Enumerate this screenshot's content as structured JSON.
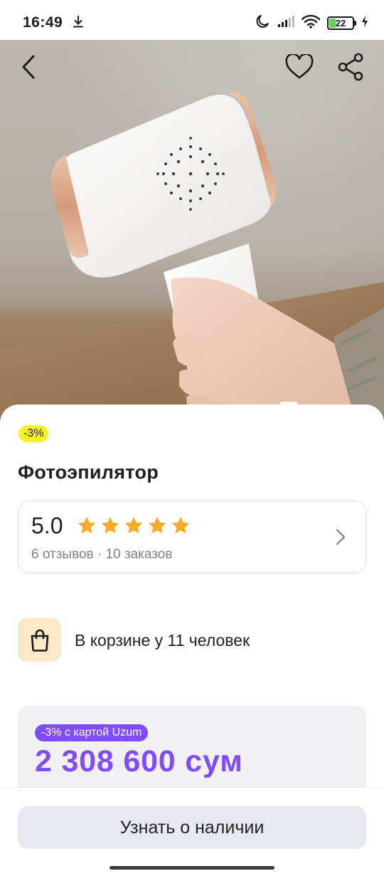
{
  "status_bar": {
    "time": "16:49",
    "battery_percent": "22",
    "icons": [
      "download-icon",
      "moon-icon",
      "signal-icon",
      "wifi-icon",
      "battery-icon",
      "charging-icon"
    ]
  },
  "header": {
    "icons": [
      "back-arrow-icon",
      "heart-icon",
      "share-icon"
    ]
  },
  "gallery": {
    "indicator_active_index": 0
  },
  "product": {
    "discount_badge": "-3%",
    "title": "Фотоэпилятор",
    "rating": {
      "value": "5.0",
      "stars": 5,
      "meta": "6 отзывов · 10 заказов"
    },
    "cart_info": "В корзине у 11 человек",
    "price_block": {
      "card_badge": "-3% с картой Uzum",
      "price": "2 308 600 сум"
    }
  },
  "bottom_bar": {
    "cta_label": "Узнать о наличии"
  },
  "colors": {
    "accent_purple": "#7f4dff",
    "badge_yellow": "#f4f224",
    "star_orange": "#f7a928",
    "cart_icon_bg": "#fbe8c6"
  }
}
